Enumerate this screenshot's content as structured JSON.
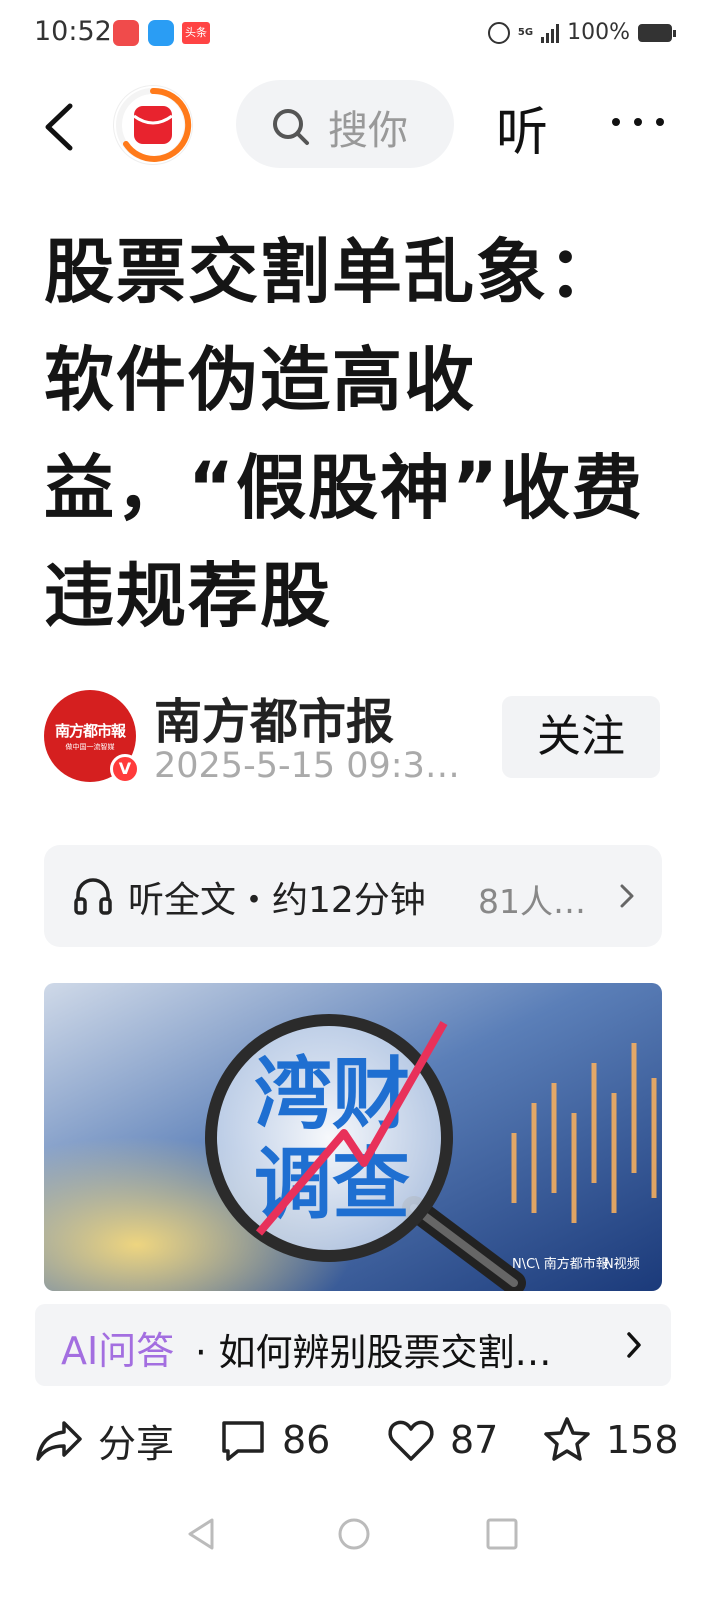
{
  "status_bar": {
    "time": "10:52",
    "network": "5G",
    "battery": "100%"
  },
  "header": {
    "search_placeholder": "搜你",
    "listen_label": "听"
  },
  "article": {
    "title": "股票交割单乱象：软件伪造高收益，“假股神”收费违规荐股"
  },
  "author": {
    "logo_text": "南方都市報",
    "logo_subtext": "做中国一流智媒",
    "badge": "V",
    "name": "南方都市报",
    "date": "2025-5-15 09:3…",
    "follow_label": "关注"
  },
  "listen_card": {
    "text": "听全文・约12分钟",
    "count": "81人…"
  },
  "hero": {
    "line1": "湾财",
    "line2": "调查",
    "watermark_left": "N\\C\\ 南方都市報",
    "watermark_right": "N视频"
  },
  "ai_card": {
    "label": "AI问答",
    "question": "· 如何辨别股票交割…"
  },
  "actions": {
    "share_label": "分享",
    "comment_count": "86",
    "like_count": "87",
    "favorite_count": "158"
  },
  "colors": {
    "accent_red": "#d51f1f",
    "ai_purple": "#a36ee0",
    "card_bg": "#f3f4f6"
  }
}
